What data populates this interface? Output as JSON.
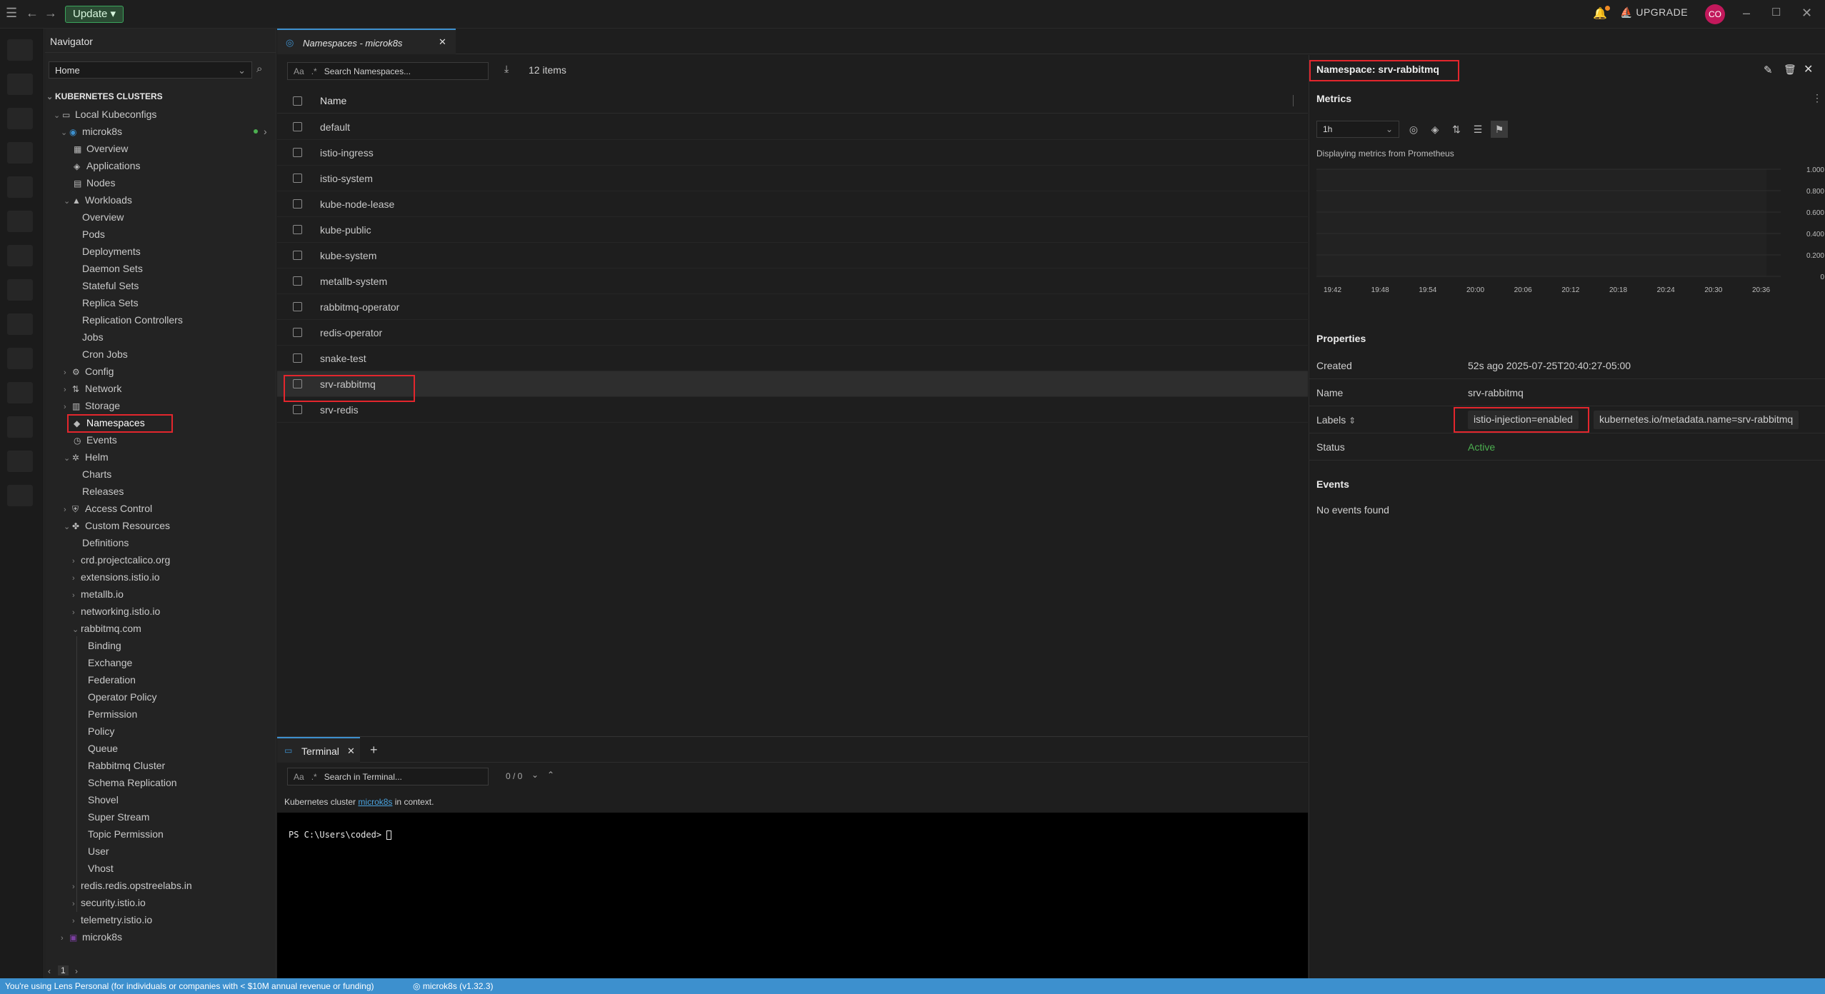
{
  "titlebar": {
    "update_label": "Update",
    "upgrade_label": "UPGRADE",
    "avatar_initials": "CO"
  },
  "navigator": {
    "title": "Navigator",
    "select_value": "Home",
    "section_title": "KUBERNETES CLUSTERS",
    "group": "Local Kubeconfigs",
    "cluster": "microk8s",
    "items": {
      "overview": "Overview",
      "applications": "Applications",
      "nodes": "Nodes",
      "workloads": "Workloads",
      "wl_overview": "Overview",
      "pods": "Pods",
      "deployments": "Deployments",
      "daemon_sets": "Daemon Sets",
      "stateful_sets": "Stateful Sets",
      "replica_sets": "Replica Sets",
      "replication_controllers": "Replication Controllers",
      "jobs": "Jobs",
      "cron_jobs": "Cron Jobs",
      "config": "Config",
      "network": "Network",
      "storage": "Storage",
      "namespaces": "Namespaces",
      "events": "Events",
      "helm": "Helm",
      "charts": "Charts",
      "releases": "Releases",
      "access_control": "Access Control",
      "custom_resources": "Custom Resources",
      "definitions": "Definitions",
      "crd_calico": "crd.projectcalico.org",
      "extensions_istio": "extensions.istio.io",
      "metallb": "metallb.io",
      "networking_istio": "networking.istio.io",
      "rabbitmq": "rabbitmq.com",
      "binding": "Binding",
      "exchange": "Exchange",
      "federation": "Federation",
      "operator_policy": "Operator Policy",
      "permission": "Permission",
      "policy": "Policy",
      "queue": "Queue",
      "rabbitmq_cluster": "Rabbitmq Cluster",
      "schema_replication": "Schema Replication",
      "shovel": "Shovel",
      "super_stream": "Super Stream",
      "topic_permission": "Topic Permission",
      "user": "User",
      "vhost": "Vhost",
      "redis_opstree": "redis.redis.opstreelabs.in",
      "security_istio": "security.istio.io",
      "telemetry_istio": "telemetry.istio.io",
      "microk8s_bottom": "microk8s"
    },
    "footer_page": "1"
  },
  "tab": {
    "label": "Namespaces - microk8s"
  },
  "list": {
    "search_aa": "Aa",
    "search_placeholder": "Search Namespaces...",
    "items_count": "12 items",
    "column_name": "Name",
    "rows": [
      "default",
      "istio-ingress",
      "istio-system",
      "kube-node-lease",
      "kube-public",
      "kube-system",
      "metallb-system",
      "rabbitmq-operator",
      "redis-operator",
      "snake-test",
      "srv-rabbitmq",
      "srv-redis"
    ]
  },
  "terminal": {
    "tab_label": "Terminal",
    "search_aa": "Aa",
    "search_placeholder": "Search in Terminal...",
    "match_count": "0 / 0",
    "context_prefix": "Kubernetes cluster",
    "context_link": "microk8s",
    "context_suffix": "in context.",
    "prompt": "PS C:\\Users\\coded> "
  },
  "details": {
    "title": "Namespace: srv-rabbitmq",
    "metrics_title": "Metrics",
    "metrics_range": "1h",
    "metrics_note": "Displaying metrics from Prometheus",
    "properties_title": "Properties",
    "created_key": "Created",
    "created_val": "52s ago 2025-07-25T20:40:27-05:00",
    "name_key": "Name",
    "name_val": "srv-rabbitmq",
    "labels_key": "Labels",
    "labels": [
      "istio-injection=enabled",
      "kubernetes.io/metadata.name=srv-rabbitmq"
    ],
    "status_key": "Status",
    "status_val": "Active",
    "events_title": "Events",
    "events_empty": "No events found"
  },
  "chart_data": {
    "type": "line",
    "x": [
      "19:42",
      "19:48",
      "19:54",
      "20:00",
      "20:06",
      "20:12",
      "20:18",
      "20:24",
      "20:30",
      "20:36"
    ],
    "yticks": [
      "1.000",
      "0.800",
      "0.600",
      "0.400",
      "0.200",
      "0"
    ],
    "ylim": [
      0,
      1
    ],
    "series": []
  },
  "statusbar": {
    "license_text": "You're using Lens Personal (for individuals or companies with < $10M annual revenue or funding)",
    "cluster_text": "microk8s (v1.32.3)"
  },
  "colors": {
    "accent": "#3d90ce",
    "highlight_box": "#e3262d",
    "status_active": "#4caf50",
    "update_green": "#3ba55c"
  }
}
